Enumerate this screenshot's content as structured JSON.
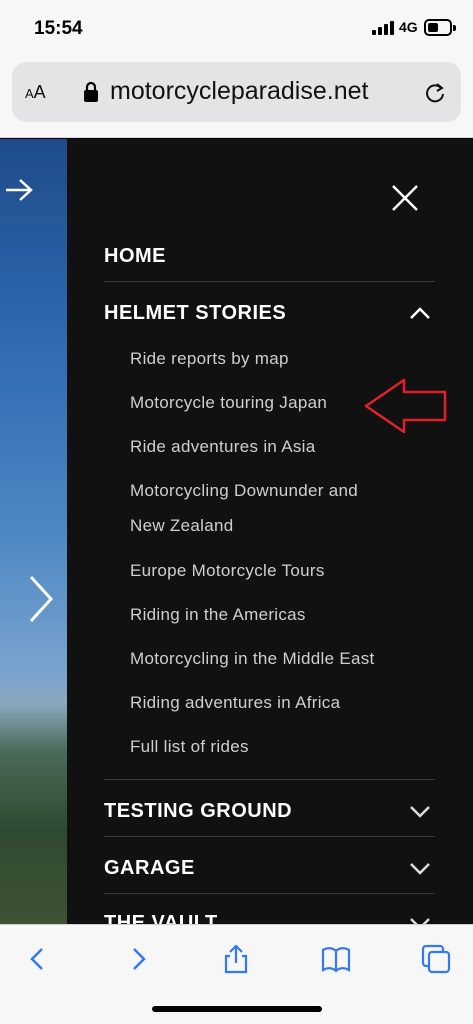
{
  "status": {
    "time": "15:54",
    "network": "4G"
  },
  "address_bar": {
    "text_size_label_small": "A",
    "text_size_label_large": "A",
    "url": "motorcycleparadise.net"
  },
  "menu": {
    "items": [
      {
        "label": "HOME"
      },
      {
        "label": "HELMET STORIES"
      },
      {
        "label": "TESTING GROUND"
      },
      {
        "label": "GARAGE"
      },
      {
        "label": "THE VAULT"
      }
    ],
    "submenu": [
      "Ride reports by map",
      "Motorcycle touring Japan",
      "Ride adventures in Asia",
      "Motorcycling Downunder and",
      "New Zealand",
      "Europe Motorcycle Tours",
      "Riding in the Americas",
      "Motorcycling in the Middle East",
      "Riding adventures in Africa",
      "Full list of rides"
    ]
  },
  "colors": {
    "accent": "#3478f6",
    "annotation_arrow": "#e0202a",
    "menu_bg": "#111111"
  }
}
